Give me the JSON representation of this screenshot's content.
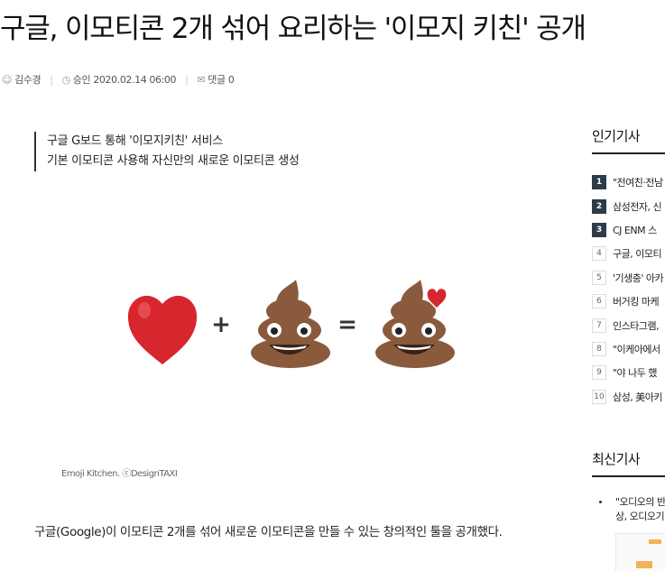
{
  "article": {
    "headline": "구글, 이모티콘 2개 섞어 요리하는 '이모지 키친' 공개",
    "reporter": "김수경",
    "approved_label": "승인",
    "approved_time": "2020.02.14 06:00",
    "comments_label": "댓글",
    "comments_count": "0",
    "summary": [
      "구글 G보드 통해 '이모지키친' 서비스",
      "기본 이모티콘 사용해 자신만의 새로운 이모티콘 생성"
    ],
    "figure": {
      "plus": "+",
      "equals": "=",
      "caption": "Emoji Kitchen. ⓒDesignTAXI"
    },
    "body_first_line": "구글(Google)이 이모티콘 2개를 섞어 새로운 이모티콘을 만들 수 있는 창의적인 툴을 공개했다."
  },
  "sidebar": {
    "popular_title": "인기기사",
    "popular": [
      {
        "num": "1",
        "label": "\"전여친·전남"
      },
      {
        "num": "2",
        "label": "삼성전자, 신"
      },
      {
        "num": "3",
        "label": "CJ ENM 스"
      },
      {
        "num": "4",
        "label": "구글, 이모티"
      },
      {
        "num": "5",
        "label": "'기생충' 아카"
      },
      {
        "num": "6",
        "label": "버거킹 마케"
      },
      {
        "num": "7",
        "label": "인스타그램,"
      },
      {
        "num": "8",
        "label": "\"이케아에서"
      },
      {
        "num": "9",
        "label": "\"야 나두 했"
      },
      {
        "num": "10",
        "label": "삼성, 美아키"
      }
    ],
    "latest_title": "최신기사",
    "latest": [
      {
        "line1": "\"오디오의 반",
        "line2": "상, 오디오기"
      }
    ]
  },
  "colors": {
    "rank_top_bg": "#2d3b47",
    "heart": "#d8262e",
    "poop": "#8a5a3c"
  }
}
